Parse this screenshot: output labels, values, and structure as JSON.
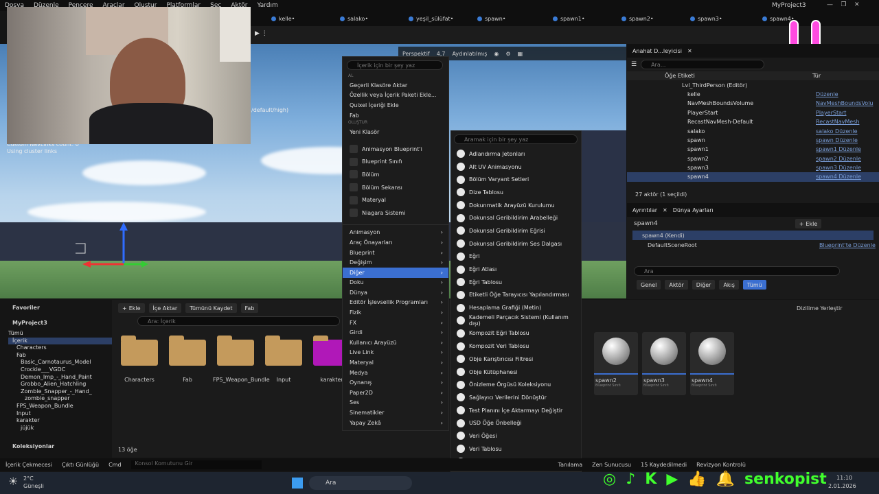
{
  "menubar": [
    "Dosya",
    "Düzenle",
    "Pencere",
    "Araçlar",
    "Oluştur",
    "Platformlar",
    "Seç",
    "Aktör",
    "Yardım"
  ],
  "project_title": "MyProject3",
  "tabs": [
    "kelle•",
    "salako•",
    "yeşil_sülüfat•",
    "spawn•",
    "spawn1•",
    "spawn2•",
    "spawn3•",
    "spawn4•"
  ],
  "viewport": {
    "perspective": "Perspektif",
    "fov": "4,7",
    "lighting": "Aydınlatılmış",
    "stats_suffix": "/default/high)",
    "navlinks": "Custom NavLinks count: 0",
    "cluster": "Using cluster links"
  },
  "outliner": {
    "title": "Anahat D...leyicisi",
    "search": "Ara...",
    "col_label": "Öğe Etiketi",
    "col_type": "Tür",
    "rows": [
      {
        "name": "Lvl_ThirdPerson (Editör)",
        "type": ""
      },
      {
        "name": "kelle",
        "type": "Düzenle"
      },
      {
        "name": "NavMeshBoundsVolume",
        "type": "NavMeshBoundsVolu"
      },
      {
        "name": "PlayerStart",
        "type": "PlayerStart"
      },
      {
        "name": "RecastNavMesh-Default",
        "type": "RecastNavMesh"
      },
      {
        "name": "salako",
        "type": "salako Düzenle"
      },
      {
        "name": "spawn",
        "type": "spawn Düzenle"
      },
      {
        "name": "spawn1",
        "type": "spawn1 Düzenle"
      },
      {
        "name": "spawn2",
        "type": "spawn2 Düzenle"
      },
      {
        "name": "spawn3",
        "type": "spawn3 Düzenle"
      },
      {
        "name": "spawn4",
        "type": "spawn4 Düzenle"
      }
    ],
    "footer": "27 aktör (1 seçildi)"
  },
  "details": {
    "tab1": "Ayrıntılar",
    "tab2": "Dünya Ayarları",
    "object": "spawn4",
    "add": "Ekle",
    "self": "spawn4 (Kendi)",
    "root": "DefaultSceneRoot",
    "bp_edit": "Blueprint'te Düzenle",
    "search": "Ara",
    "filters": [
      "Genel",
      "Aktör",
      "Diğer",
      "Akış",
      "Tümü"
    ]
  },
  "content": {
    "favorites": "Favoriler",
    "project": "MyProject3",
    "collections": "Koleksiyonlar",
    "add": "Ekle",
    "import": "İçe Aktar",
    "save_all": "Tümünü Kaydet",
    "fab": "Fab",
    "search": "Ara: İçerik",
    "count": "13 öğe",
    "dock": "Dizilime Yerleştir",
    "tree": [
      "Tümü",
      "İçerik",
      "Characters",
      "Fab",
      "Basic_Carnotaurus_Model",
      "Crockie___VGDC",
      "Demon_Imp_-_Hand_Paint",
      "Grobbo_Alien_Hatchling",
      "Zombie_Snapper_-_Hand_",
      "zombie_snapper",
      "FPS_Weapon_Bundle",
      "Input",
      "karakter",
      "jüjük"
    ],
    "folders": [
      "Characters",
      "Fab",
      "FPS_Weapon_Bundle",
      "Input",
      "karakter"
    ],
    "blueprints": [
      "spawn2",
      "spawn3",
      "spawn4"
    ],
    "bp_type": "Blueprint Sınıfı"
  },
  "ctx1": {
    "search": "İçerik için bir şey yaz",
    "top": [
      "Geçerli Klasöre Aktar",
      "Özellik veya İçerik Paketi Ekle...",
      "Quixel İçeriği Ekle",
      "Fab"
    ],
    "new_folder": "Yeni Klasör",
    "basic": [
      "Animasyon Blueprint'i",
      "Blueprint Sınıfı",
      "Bölüm",
      "Bölüm Sekansı",
      "Materyal",
      "Niagara Sistemi"
    ],
    "cats": [
      "Animasyon",
      "Araç Önayarları",
      "Blueprint",
      "Değişim",
      "Diğer",
      "Doku",
      "Dünya",
      "Editör İşlevsellik Programları",
      "Fizik",
      "FX",
      "Girdi",
      "Kullanıcı Arayüzü",
      "Live Link",
      "Materyal",
      "Medya",
      "Oynanış",
      "Paper2D",
      "Ses",
      "Sinematikler",
      "Yapay Zekâ"
    ]
  },
  "ctx2": {
    "search": "Aramak için bir şey yaz",
    "items": [
      "Adlandırma Jetonları",
      "Alt UV Animasyonu",
      "Bölüm Varyant Setleri",
      "Dize Tablosu",
      "Dokunmatik Arayüzü Kurulumu",
      "Dokunsal Geribildirim Arabelleği",
      "Dokunsal Geribildirim Eğrisi",
      "Dokunsal Geribildirim Ses Dalgası",
      "Eğri",
      "Eğri Atlası",
      "Eğri Tablosu",
      "Etiketli Öğe Tarayıcısı Yapılandırması",
      "Hesaplama Grafiği (Metin)",
      "Kademeli Parçacık Sistemi (Kullanım dışı)",
      "Kompozit Eğri Tablosu",
      "Kompozit Veri Tablosu",
      "Obje Karıştırıcısı Filtresi",
      "Obje Kütüphanesi",
      "Önizleme Örgüsü Koleksiyonu",
      "Sağlayıcı Verilerini Dönüştür",
      "Test Planını İçe Aktarmayı Değiştir",
      "USD Öğe Önbelleği",
      "Veri Öğesi",
      "Veri Tablosu",
      "Yavaşlatma Eğrisi Kütüphanesi"
    ]
  },
  "status": {
    "drawer": "İçerik Çekmecesi",
    "log": "Çıktı Günlüğü",
    "cmd": "Cmd",
    "console": "Konsol Komutunu Gir",
    "trace": "Tanılama",
    "zen": "Zen Sunucusu",
    "saved": "15 Kaydedilmedi",
    "rev": "Revizyon Kontrolü"
  },
  "taskbar": {
    "temp": "2°C",
    "weather": "Güneşli",
    "search": "Ara",
    "time": "11:10",
    "date": "2.01.2026"
  },
  "social": "senkopist"
}
